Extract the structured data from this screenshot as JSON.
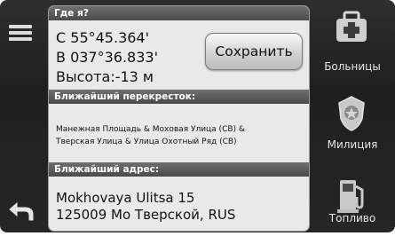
{
  "where_am_i": {
    "title": "Где я?",
    "lat": "С 55°45.364'",
    "lon": "В 037°36.833'",
    "elevation": "Высота:-13 м",
    "save_label": "Сохранить"
  },
  "nearest_intersection": {
    "title": "Ближайший перекресток:",
    "line1": "Манежная Площадь & Моховая Улица (СВ) &",
    "line2": "Тверская Улица & Улица Охотный Ряд (СВ)"
  },
  "nearest_address": {
    "title": "Ближайший адрес:",
    "line1": "Mokhovaya Ulitsa 15",
    "line2": "125009 Мо Тверской, RUS"
  },
  "poi": [
    {
      "label": "Больницы",
      "icon": "hospital-icon"
    },
    {
      "label": "Милиция",
      "icon": "police-badge-icon"
    },
    {
      "label": "Топливо",
      "icon": "fuel-pump-icon"
    }
  ],
  "nav": {
    "menu_icon": "menu-icon",
    "back_icon": "back-arrow-icon"
  }
}
